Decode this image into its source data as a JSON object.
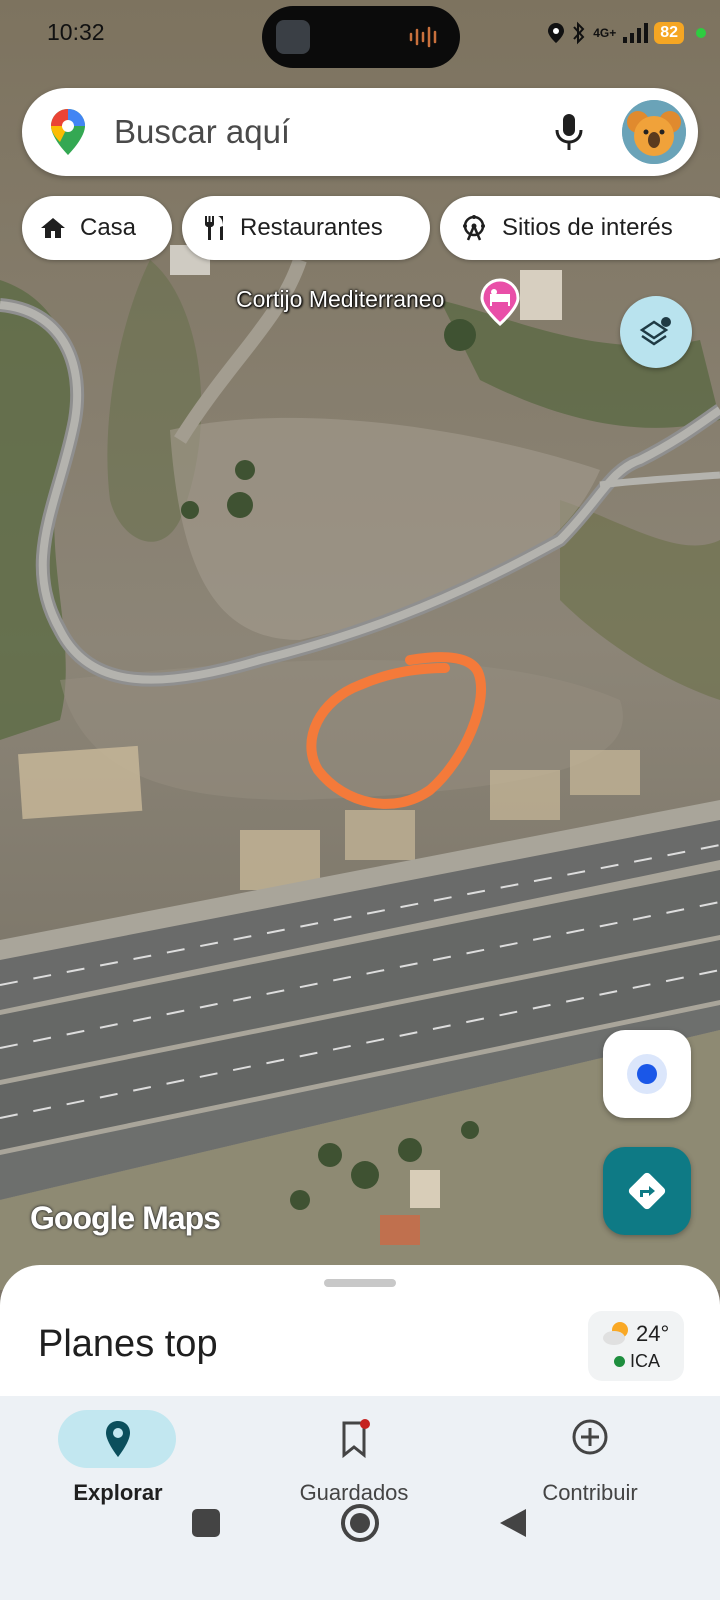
{
  "status_bar": {
    "time": "10:32",
    "network": "4G+",
    "battery": "82"
  },
  "search": {
    "placeholder": "Buscar aquí"
  },
  "chips": [
    {
      "label": "Casa",
      "icon": "home-icon"
    },
    {
      "label": "Restaurantes",
      "icon": "restaurant-icon"
    },
    {
      "label": "Sitios de interés",
      "icon": "ferris-wheel-icon"
    }
  ],
  "map": {
    "place_label": "Cortijo Mediterraneo",
    "watermark": "Google Maps",
    "annotation_color": "#f47a3a"
  },
  "sheet": {
    "title": "Planes top",
    "weather": {
      "temp": "24°",
      "aqi": "ICA"
    }
  },
  "bottom_nav": [
    {
      "label": "Explorar",
      "icon": "location-pin-icon",
      "active": true
    },
    {
      "label": "Guardados",
      "icon": "bookmark-icon",
      "active": false
    },
    {
      "label": "Contribuir",
      "icon": "add-circle-icon",
      "active": false
    }
  ],
  "colors": {
    "accent": "#0e7a85",
    "active_nav": "#c2e7f0",
    "layers_button": "#b9e3ee"
  }
}
